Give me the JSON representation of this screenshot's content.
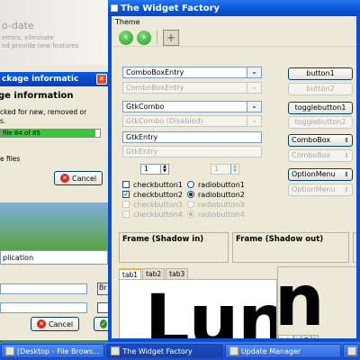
{
  "background_update_window": {
    "title": "o-date",
    "description_lines": [
      "errors, eliminate",
      "nd provide new features"
    ]
  },
  "package_dialog": {
    "titlebar": "ckage informatic",
    "heading": "ge information",
    "message_lines": [
      "cked for new, removed or",
      "s."
    ],
    "progress": {
      "text": "file 84 of 85",
      "fraction": 0.95
    },
    "files_text": "e files",
    "cancel_label": "Cancel"
  },
  "app_dialog": {
    "field_label": "plication",
    "b2_label": "Br",
    "cancel_label": "Cancel"
  },
  "widget_factory": {
    "title": "The Widget Factory",
    "menu": [
      "Theme"
    ],
    "toolbar": {
      "back_icon": "back-arrow-icon",
      "forward_icon": "forward-arrow-icon",
      "add_icon": "add-icon"
    },
    "combos": [
      {
        "label": "ComboBoxEntry",
        "disabled": false
      },
      {
        "label": "ComboBoxEntry",
        "disabled": true
      },
      {
        "label": "GtkCombo",
        "disabled": false
      },
      {
        "label": "GtkCombo (Disabled)",
        "disabled": true
      },
      {
        "label": "GtkEntry",
        "disabled": false
      },
      {
        "label": "GtkEntry",
        "disabled": true
      }
    ],
    "right_buttons": {
      "button1": "button1",
      "button2": "button2",
      "togglebutton1": "togglebutton1",
      "togglebutton2": "togglebutton2",
      "combobox1": "ComboBox",
      "combobox2": "ComboBox",
      "optionmenu1": "OptionMenu",
      "optionmenu2": "OptionMenu"
    },
    "spin1": "1",
    "spin2": "1",
    "checks": [
      {
        "label": "checkbutton1",
        "checked": false,
        "disabled": false
      },
      {
        "label": "checkbutton2",
        "checked": true,
        "disabled": false
      },
      {
        "label": "checkbutton3",
        "checked": false,
        "disabled": true
      },
      {
        "label": "checkbutton4",
        "checked": true,
        "disabled": true
      }
    ],
    "radios": [
      {
        "label": "radiobutton1",
        "on": false,
        "disabled": false
      },
      {
        "label": "radiobutton2",
        "on": true,
        "disabled": false
      },
      {
        "label": "radiobutton3",
        "on": false,
        "disabled": true
      },
      {
        "label": "radiobutton4",
        "on": true,
        "disabled": true
      }
    ],
    "frames": [
      "Frame (Shadow in)",
      "Frame (Shadow out)",
      "F"
    ],
    "notebook_tabs": [
      "tab1",
      "tab2",
      "tab3"
    ],
    "notebook_text": "Lun",
    "notebook2_tabs": [
      "tab",
      "ab2",
      "t"
    ],
    "notebook2_text": "n"
  },
  "taskbar": {
    "items": [
      {
        "label": "[Desktop - File Brows...",
        "active": false
      },
      {
        "label": "The Widget Factory",
        "active": true
      },
      {
        "label": "Update Manager",
        "active": false
      },
      {
        "label": "",
        "active": false
      }
    ]
  },
  "colors": {
    "titlebar_blue": "#0a56d8",
    "progress_green": "#3ec43e",
    "accent_tab": "#f0b43c"
  }
}
